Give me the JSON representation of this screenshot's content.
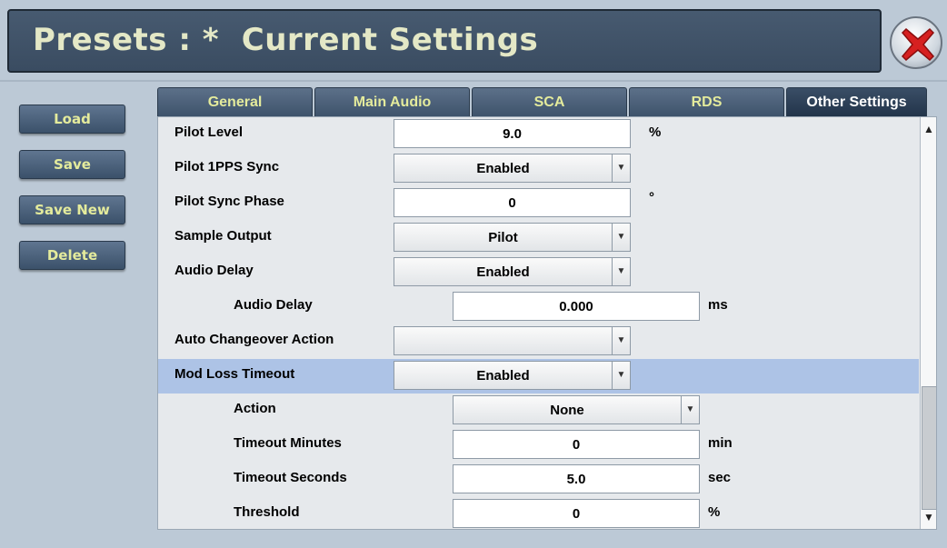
{
  "header": {
    "title": "Presets : *  Current Settings",
    "close_icon": "close-x-icon"
  },
  "sidebar": {
    "buttons": [
      {
        "label": "Load"
      },
      {
        "label": "Save"
      },
      {
        "label": "Save New"
      },
      {
        "label": "Delete"
      }
    ]
  },
  "tabs": [
    {
      "label": "General",
      "active": false
    },
    {
      "label": "Main Audio",
      "active": false
    },
    {
      "label": "SCA",
      "active": false
    },
    {
      "label": "RDS",
      "active": false
    },
    {
      "label": "Other Settings",
      "active": true
    }
  ],
  "rows": [
    {
      "label": "Pilot Level",
      "type": "field",
      "value": "9.0",
      "unit": "%"
    },
    {
      "label": "Pilot 1PPS Sync",
      "type": "select",
      "value": "Enabled",
      "unit": ""
    },
    {
      "label": "Pilot Sync Phase",
      "type": "field",
      "value": "0",
      "unit": "°"
    },
    {
      "label": "Sample Output",
      "type": "select",
      "value": "Pilot",
      "unit": ""
    },
    {
      "label": "Audio Delay",
      "type": "select",
      "value": "Enabled",
      "unit": ""
    },
    {
      "label": "Audio Delay",
      "type": "field",
      "value": "0.000",
      "unit": "ms"
    },
    {
      "label": "Auto Changeover Action",
      "type": "select",
      "value": "",
      "unit": ""
    },
    {
      "label": "Mod Loss Timeout",
      "type": "select",
      "value": "Enabled",
      "unit": ""
    },
    {
      "label": "Action",
      "type": "select",
      "value": "None",
      "unit": ""
    },
    {
      "label": "Timeout Minutes",
      "type": "field",
      "value": "0",
      "unit": "min"
    },
    {
      "label": "Timeout Seconds",
      "type": "field",
      "value": "5.0",
      "unit": "sec"
    },
    {
      "label": "Threshold",
      "type": "field",
      "value": "0",
      "unit": "%"
    }
  ],
  "colors": {
    "header_bg": "#3a4c61",
    "title_text": "#e4e8c6",
    "button_text": "#e4eb9c",
    "highlight_row": "#adc3e6",
    "close_red": "#d62020"
  }
}
